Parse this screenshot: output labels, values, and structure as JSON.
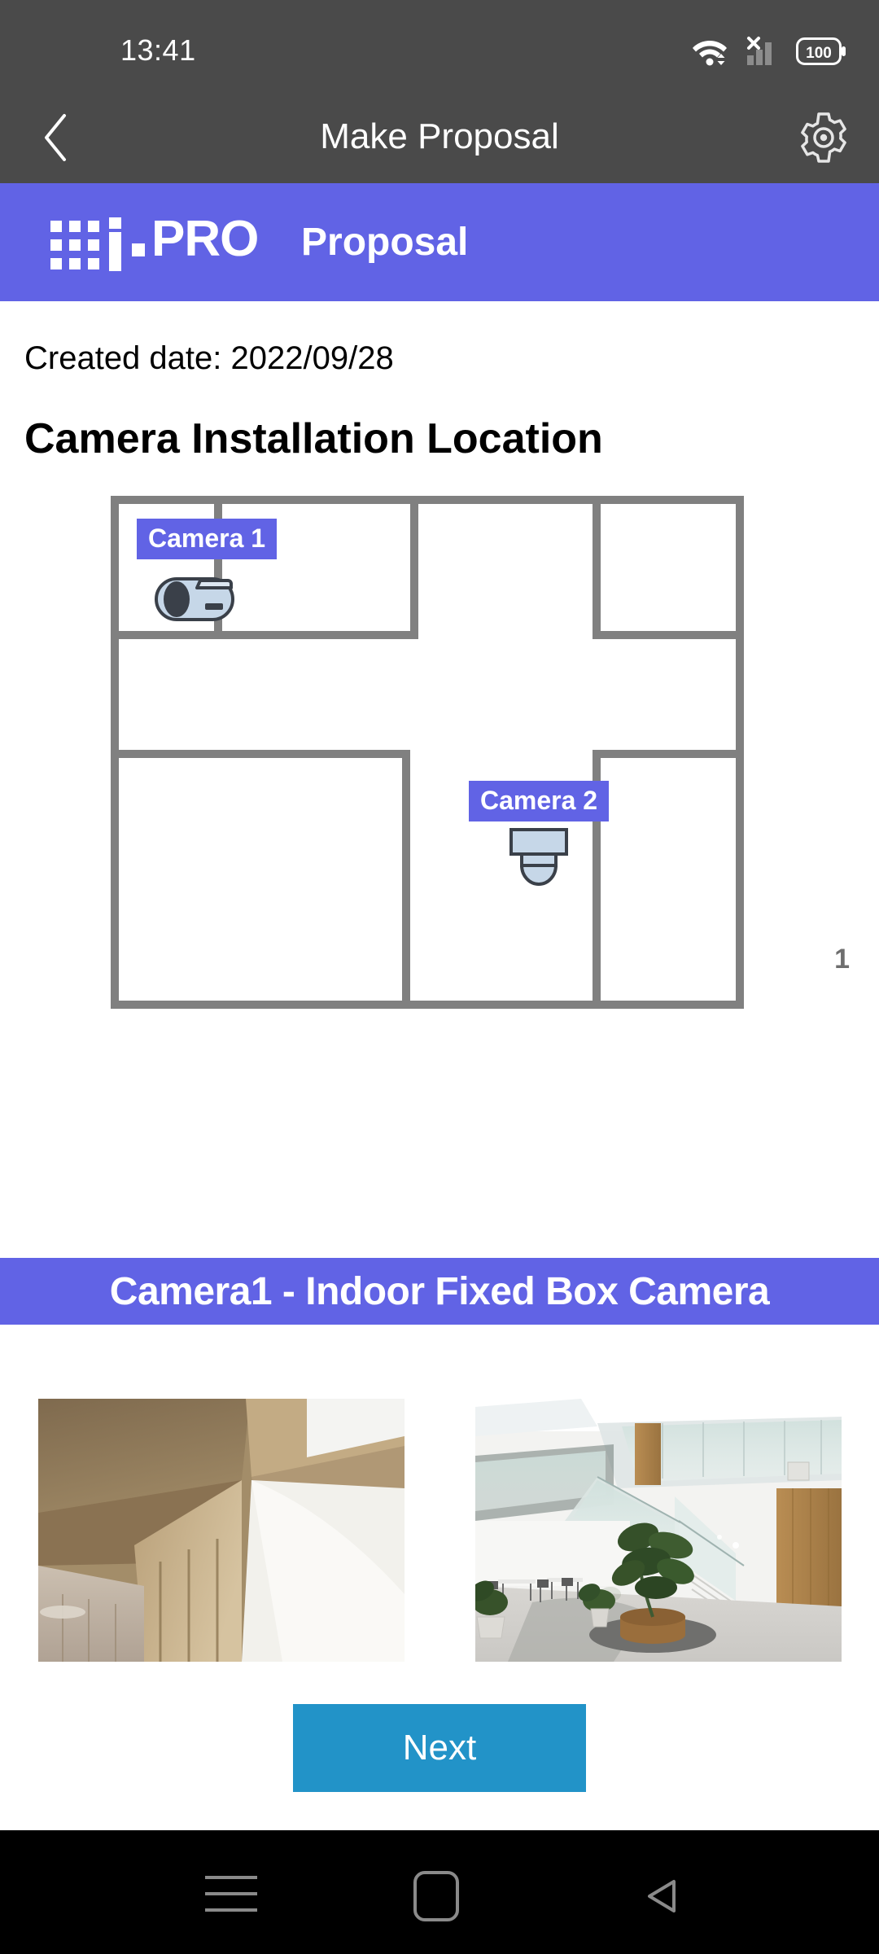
{
  "status_bar": {
    "time": "13:41",
    "battery_level": "100",
    "icons": [
      "wifi-icon",
      "mobile-signal-off-icon",
      "battery-icon"
    ]
  },
  "app_bar": {
    "title": "Make Proposal",
    "back_icon": "chevron-left-icon",
    "settings_icon": "gear-icon"
  },
  "brand_bar": {
    "logo_text": "PRO",
    "logo_name": "i-pro-logo",
    "subtitle": "Proposal",
    "color": "#6163e5"
  },
  "document": {
    "created_date_label": "Created date: 2022/09/28",
    "title": "Camera Installation Location",
    "page_number": "1"
  },
  "floor_plan": {
    "cameras": [
      {
        "label": "Camera 1",
        "type": "box-camera-icon"
      },
      {
        "label": "Camera 2",
        "type": "dome-camera-icon"
      }
    ],
    "wall_color": "#808080"
  },
  "camera_section": {
    "banner": "Camera1 - Indoor Fixed Box Camera",
    "photos": [
      {
        "name": "ceiling-corner-photo",
        "description": "Interior ceiling corner with wood panelling"
      },
      {
        "name": "atrium-staircase-photo",
        "description": "Building atrium with glass railing staircase and plants"
      }
    ]
  },
  "actions": {
    "next_label": "Next",
    "next_color": "#2293c8"
  },
  "nav_bar": {
    "recents_icon": "recents-icon",
    "home_icon": "home-icon",
    "back_icon": "back-triangle-icon"
  }
}
